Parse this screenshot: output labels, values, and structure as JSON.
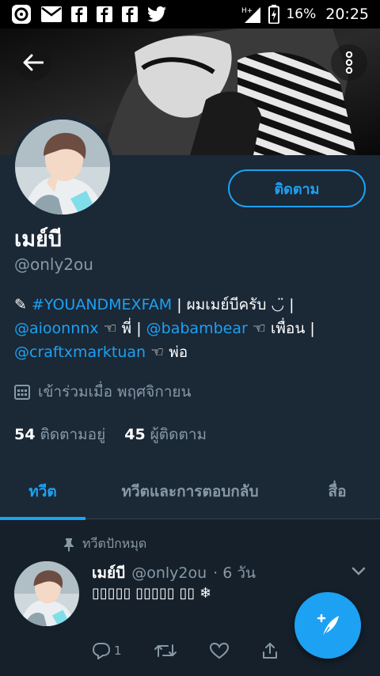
{
  "status_bar": {
    "battery_percent": "16%",
    "time": "20:25",
    "network": "H+",
    "notification_icons": [
      "circle-app-icon",
      "mail-icon",
      "facebook-icon",
      "facebook-icon",
      "facebook-icon",
      "twitter-icon"
    ]
  },
  "profile": {
    "display_name": "เมย์บี",
    "handle": "@only2ou",
    "follow_label": "ติดตาม",
    "bio": {
      "line1_prefix": "✎ ",
      "hashtag": "#YOUANDMEXFAM",
      "line1_text": " | ผมเมย์บีครับ ◡̈ |",
      "mention1": "@aioonnnx",
      "mention1_suffix": " ☜ พี่ | ",
      "mention2": "@babambear",
      "mention2_suffix": " ☜ เพื่อน |",
      "mention3": "@craftxmarktuan",
      "mention3_suffix": " ☜ พ่อ"
    },
    "joined": "เข้าร่วมเมื่อ พฤศจิกายน",
    "following_count": "54",
    "following_label": "ติดตามอยู่",
    "followers_count": "45",
    "followers_label": "ผู้ติดตาม"
  },
  "tabs": [
    {
      "label": "ทวีต",
      "active": true
    },
    {
      "label": "ทวีตและการตอบกลับ",
      "active": false
    },
    {
      "label": "สื่อ",
      "active": false
    }
  ],
  "tweet": {
    "pinned_label": "ทวีตปักหมุด",
    "name": "เมย์บี",
    "handle": "@only2ou",
    "age": "· 6 วัน",
    "text": "▯▯▯▯▯ ▯▯▯▯▯ ▯▯ ❄",
    "reply_count": "1"
  },
  "colors": {
    "accent": "#1da1f2",
    "background": "#15202b",
    "panel": "#1b2836",
    "muted": "#8899a6"
  }
}
